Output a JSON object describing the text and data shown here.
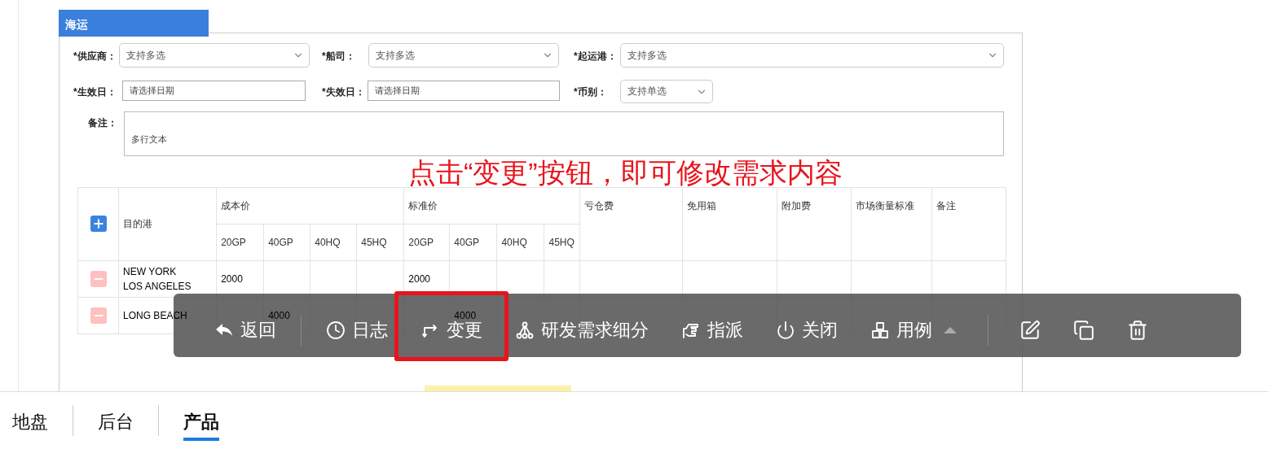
{
  "section_tab": "海运",
  "form_rows": [
    [
      {
        "label": "*供应商：",
        "kind": "select",
        "placeholder": "支持多选"
      },
      {
        "label": "*船司：",
        "kind": "select",
        "placeholder": "支持多选"
      },
      {
        "label": "*起运港：",
        "kind": "select",
        "placeholder": "支持多选"
      }
    ],
    [
      {
        "label": "*生效日：",
        "kind": "date",
        "placeholder": "请选择日期"
      },
      {
        "label": "*失效日：",
        "kind": "date",
        "placeholder": "请选择日期"
      },
      {
        "label": "*币别：",
        "kind": "select",
        "placeholder": "支持单选"
      }
    ],
    [
      {
        "label": "备注：",
        "kind": "textarea",
        "placeholder": "多行文本"
      }
    ]
  ],
  "table": {
    "destination_header": "目的港",
    "groups": [
      {
        "label": "成本价",
        "columns": [
          "20GP",
          "40GP",
          "40HQ",
          "45HQ"
        ]
      },
      {
        "label": "标准价",
        "columns": [
          "20GP",
          "40GP",
          "40HQ",
          "45HQ"
        ]
      }
    ],
    "extra_columns": [
      "亏仓费",
      "免用箱",
      "附加费",
      "市场衡量标准",
      "备注"
    ],
    "rows": [
      {
        "destinations": [
          "NEW YORK",
          "LOS ANGELES"
        ],
        "cost_20gp": "2000",
        "standard_20gp": "2000"
      },
      {
        "destinations": [
          "LONG BEACH"
        ],
        "cost_40gp": "4000",
        "standard_40gp": "4000"
      }
    ]
  },
  "annotation": "点击“变更”按钮，即可修改需求内容",
  "toolbar": [
    [
      {
        "kind": "back",
        "label": "返回"
      }
    ],
    [
      {
        "kind": "log",
        "label": "日志"
      },
      {
        "kind": "change",
        "label": "变更",
        "highlighted": true
      },
      {
        "kind": "split",
        "label": "研发需求细分"
      },
      {
        "kind": "assign",
        "label": "指派"
      },
      {
        "kind": "close",
        "label": "关闭"
      },
      {
        "kind": "cases",
        "label": "用例",
        "has_dropdown": true
      }
    ],
    [
      {
        "kind": "edit"
      },
      {
        "kind": "copy"
      },
      {
        "kind": "delete"
      }
    ]
  ],
  "bottom_tabs": [
    {
      "label": "地盘",
      "selected": false
    },
    {
      "label": "后台",
      "selected": false
    },
    {
      "label": "产品",
      "selected": true
    }
  ]
}
